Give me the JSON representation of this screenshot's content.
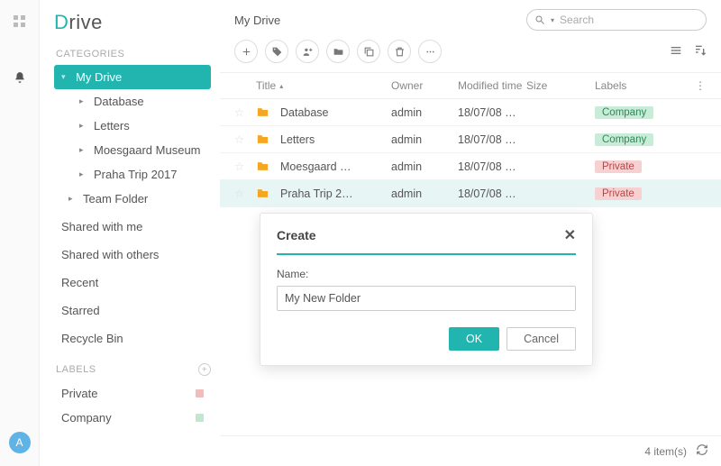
{
  "app": {
    "logo_prefix": "D",
    "logo_rest": "rive"
  },
  "leftbar": {
    "avatar_initial": "A"
  },
  "sidebar": {
    "categories_label": "CATEGORIES",
    "my_drive": "My Drive",
    "children": [
      {
        "label": "Database"
      },
      {
        "label": "Letters"
      },
      {
        "label": "Moesgaard Museum"
      },
      {
        "label": "Praha Trip 2017"
      }
    ],
    "team_folder": "Team Folder",
    "links": {
      "shared_with_me": "Shared with me",
      "shared_with_others": "Shared with others",
      "recent": "Recent",
      "starred": "Starred",
      "recycle": "Recycle Bin"
    },
    "labels_label": "LABELS",
    "labels": [
      {
        "name": "Private",
        "color": "#f2bcbc"
      },
      {
        "name": "Company",
        "color": "#bfe8cf"
      }
    ]
  },
  "header": {
    "title": "My Drive",
    "search_placeholder": "Search"
  },
  "columns": {
    "title": "Title",
    "owner": "Owner",
    "mtime": "Modified time",
    "size": "Size",
    "labels": "Labels"
  },
  "rows": [
    {
      "name": "Database",
      "owner": "admin",
      "mtime": "18/07/08 …",
      "label": "Company",
      "label_kind": "company"
    },
    {
      "name": "Letters",
      "owner": "admin",
      "mtime": "18/07/08 …",
      "label": "Company",
      "label_kind": "company"
    },
    {
      "name": "Moesgaard …",
      "owner": "admin",
      "mtime": "18/07/08 …",
      "label": "Private",
      "label_kind": "private"
    },
    {
      "name": "Praha Trip 2…",
      "owner": "admin",
      "mtime": "18/07/08 …",
      "label": "Private",
      "label_kind": "private",
      "selected": true
    }
  ],
  "footer": {
    "count_text": "4 item(s)"
  },
  "modal": {
    "title": "Create",
    "name_label": "Name:",
    "input_value": "My New Folder",
    "ok": "OK",
    "cancel": "Cancel"
  }
}
